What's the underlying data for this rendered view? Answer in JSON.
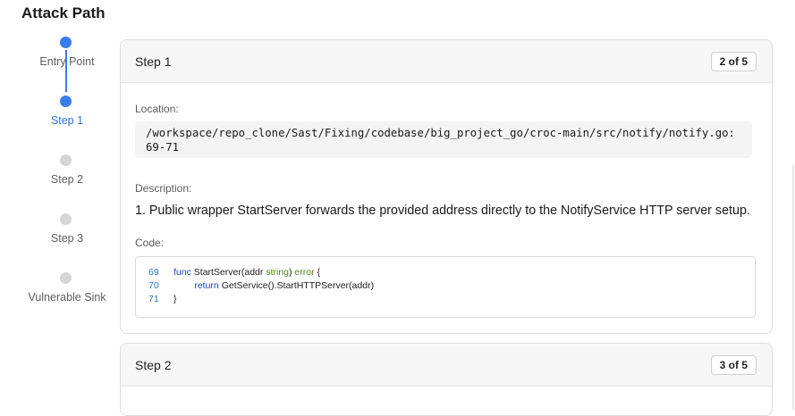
{
  "page": {
    "title": "Attack Path"
  },
  "timeline": {
    "nodes": [
      {
        "label": "Entry Point",
        "state": "done"
      },
      {
        "label": "Step 1",
        "state": "current"
      },
      {
        "label": "Step 2",
        "state": "pending"
      },
      {
        "label": "Step 3",
        "state": "pending"
      },
      {
        "label": "Vulnerable Sink",
        "state": "pending"
      }
    ]
  },
  "cards": [
    {
      "title": "Step 1",
      "badge": "2 of 5",
      "location_label": "Location:",
      "location": "/workspace/repo_clone/Sast/Fixing/codebase/big_project_go/croc-main/src/notify/notify.go:69-71",
      "description_label": "Description:",
      "description": "1. Public wrapper StartServer forwards the provided address directly to the NotifyService HTTP server setup.",
      "code_label": "Code:",
      "code": [
        {
          "line": "69",
          "parts": [
            {
              "t": "func",
              "k": "kw"
            },
            {
              "t": " StartServer(addr ",
              "k": ""
            },
            {
              "t": "string",
              "k": "ty"
            },
            {
              "t": ") ",
              "k": ""
            },
            {
              "t": "error",
              "k": "ty"
            },
            {
              "t": " {",
              "k": ""
            }
          ]
        },
        {
          "line": "70",
          "parts": [
            {
              "t": "        ",
              "k": ""
            },
            {
              "t": "return",
              "k": "kw"
            },
            {
              "t": " GetService().StartHTTPServer(addr)",
              "k": ""
            }
          ]
        },
        {
          "line": "71",
          "parts": [
            {
              "t": "}",
              "k": ""
            }
          ]
        }
      ]
    },
    {
      "title": "Step 2",
      "badge": "3 of 5"
    }
  ],
  "colors": {
    "accent": "#3b7bf0",
    "inactive_dot": "#d6d6d6",
    "keyword": "#1a3fc4",
    "type": "#4f8a1a",
    "line_number": "#2a7ab5"
  }
}
